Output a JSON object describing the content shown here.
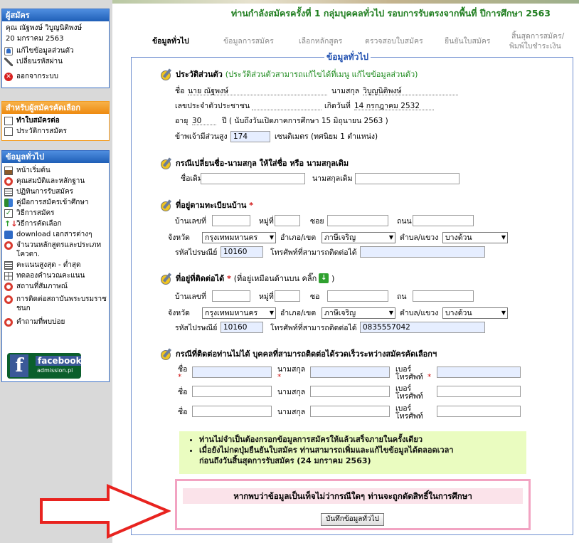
{
  "sidebar": {
    "applicant": {
      "header": "ผู้สมัคร",
      "name": "คุณ ณัฐพงษ์ วิบูญนิติพงษ์",
      "date": "20 มกราคม 2563",
      "items": [
        {
          "label": "แก้ไขข้อมูลส่วนตัว",
          "icon": "person-edit-icon"
        },
        {
          "label": "เปลี่ยนรหัสผ่าน",
          "icon": "tools-icon"
        },
        {
          "label": "ออกจากระบบ",
          "icon": "exit-icon"
        }
      ]
    },
    "selected": {
      "header": "สำหรับผู้สมัครคัดเลือก",
      "items": [
        {
          "label": "ทำใบสมัครต่อ",
          "icon": "document-icon"
        },
        {
          "label": "ประวัติการสมัคร",
          "icon": "document-icon"
        }
      ]
    },
    "general": {
      "header": "ข้อมูลทั่วไป",
      "items": [
        {
          "label": "หน้าเริ่มต้น",
          "icon": "home-icon"
        },
        {
          "label": "คุณสมบัติและหลักฐาน",
          "icon": "lifebuoy-icon"
        },
        {
          "label": "ปฏิทินการรับสมัคร",
          "icon": "list-icon"
        },
        {
          "label": "คู่มือการสมัครเข้าศึกษา",
          "icon": "book-icon"
        },
        {
          "label": "วิธีการสมัคร",
          "icon": "checklist-icon"
        },
        {
          "label": "วิธีการคัดเลือก",
          "icon": "arrows-icon"
        },
        {
          "label": "download เอกสารต่างๆ",
          "icon": "download-icon"
        },
        {
          "label": "จำนวนหลักสูตรและประเภทโควตา.",
          "icon": "lifebuoy-icon"
        },
        {
          "label": "คะแนนสูงสุด - ต่ำสุด",
          "icon": "list-icon"
        },
        {
          "label": "ทดลองคำนวณคะแนน",
          "icon": "grid-icon"
        },
        {
          "label": "สถานที่สัมภาษณ์",
          "icon": "lifebuoy-icon"
        },
        {
          "label": "การติดต่อสถาบันพระบรมราชชนก",
          "icon": "lifebuoy-icon"
        },
        {
          "label": "คำถามที่พบบ่อย",
          "icon": "lifebuoy-icon"
        }
      ]
    },
    "facebook": {
      "word": "facebook",
      "sub": "admission.pi",
      "letter": "f"
    }
  },
  "header": {
    "status": "ท่านกำลังสมัครครั้งที่ 1 กลุ่มบุคคลทั่วไป รอบการรับตรงจากพื้นที่ ปีการศึกษา 2563",
    "steps": [
      "ข้อมูลทั่วไป",
      "ข้อมูลการสมัคร",
      "เลือกหลักสูตร",
      "ตรวจสอบใบสมัคร",
      "ยืนยันใบสมัคร",
      "สิ้นสุดการสมัคร/",
      "พิมพ์ใบชำระเงิน"
    ]
  },
  "form": {
    "legend": "ข้อมูลทั่วไป",
    "personal": {
      "title": "ประวัติส่วนตัว",
      "note": "(ประวัติส่วนตัวสามารถแก้ไขได้ที่เมนู แก้ไขข้อมูลส่วนตัว)",
      "name_label": "ชื่อ",
      "name_value": "นาย          ณัฐพงษ์",
      "surname_label": "นามสกุล",
      "surname_value": "วิบูญนิติพงษ์",
      "id_label": "เลขประจำตัวประชาชน",
      "birth_label": "เกิดวันที่",
      "birth_value": "14 กรกฎาคม 2532",
      "age_label": "อายุ",
      "age_value": "30",
      "age_suffix": "ปี  ( นับถึงวันเปิดภาคการศึกษา 15 มิถุนายน 2563 )",
      "height_label": "ข้าพเจ้ามีส่วนสูง",
      "height_value": "174",
      "height_suffix": "เซนติเมตร (ทศนิยม 1 ตำแหน่ง)"
    },
    "namechange": {
      "title": "กรณีเปลี่ยนชื่อ-นามสกุล ให้ใส่ชื่อ หรือ นามสกุลเดิม",
      "old_name_label": "ชื่อเดิม",
      "old_surname_label": "นามสกุลเดิม"
    },
    "home": {
      "title": "ที่อยู่ตามทะเบียนบ้าน",
      "req": "*",
      "house_label": "บ้านเลขที่",
      "moo_label": "หมู่ที่",
      "soi_label": "ซอย",
      "road_label": "ถนน",
      "province_label": "จังหวัด",
      "province_value": "กรุงเทพมหานคร",
      "district_label": "อำเภอ/เขต",
      "district_value": "ภาษีเจริญ",
      "subdistrict_label": "ตำบล/แขวง",
      "subdistrict_value": "บางด้วน",
      "zip_label": "รหัสไปรษณีย์",
      "zip_value": "10160",
      "phone_label": "โทรศัพท์ที่สามารถติดต่อได้"
    },
    "contact": {
      "title": "ที่อยู่ที่ติดต่อได้",
      "req": "*",
      "note": "(ที่อยู่เหมือนด้านบน คลิ๊ก",
      "note_end": ")",
      "house_label": "บ้านเลขที่",
      "moo_label": "หมู่ที่",
      "soi_label": "ซอ",
      "road_label": "ถน",
      "province_label": "จังหวัด",
      "province_value": "กรุงเทพมหานคร",
      "district_label": "อำเภอ/เขต",
      "district_value": "ภาษีเจริญ",
      "subdistrict_label": "ตำบล/แขวง",
      "subdistrict_value": "บางด้วน",
      "zip_label": "รหัสไปรษณีย์",
      "zip_value": "10160",
      "phone_label": "โทรศัพท์ที่สามารถติดต่อได้",
      "phone_value": "0835557042"
    },
    "emergency": {
      "title": "กรณีที่ติดต่อท่านไม่ได้ บุคคลที่สามารถติดต่อได้รวดเร็วระหว่างสมัครคัดเลือกฯ",
      "name_label": "ชื่อ",
      "surname_label": "นามสกุล",
      "phone_label": "เบอร์",
      "phone_label2": "โทรศัพท์",
      "req": "*"
    },
    "notes": [
      "ท่านไม่จำเป็นต้องกรอกข้อมูลการสมัครให้แล้วเสร็จภายในครั้งเดียว",
      "เมื่อยังไม่กดปุ่มยืนยันใบสมัคร ท่านสามารถเพิ่มและแก้ไขข้อมูลได้ตลอดเวลา",
      "ก่อนถึงวันสิ้นสุดการรับสมัคร (24 มกราคม 2563)"
    ],
    "warning": "หากพบว่าข้อมูลเป็นเท็จไม่ว่ากรณีใดๆ ท่านจะถูกตัดสิทธิ์ในการศึกษา",
    "save_label": "บันทึกข้อมูลทั่วไป"
  },
  "colors": {
    "accent_blue": "#3a6fc4",
    "accent_orange": "#f39b1f",
    "arrow_red": "#e8231f",
    "status_green": "#1e7d1e"
  }
}
